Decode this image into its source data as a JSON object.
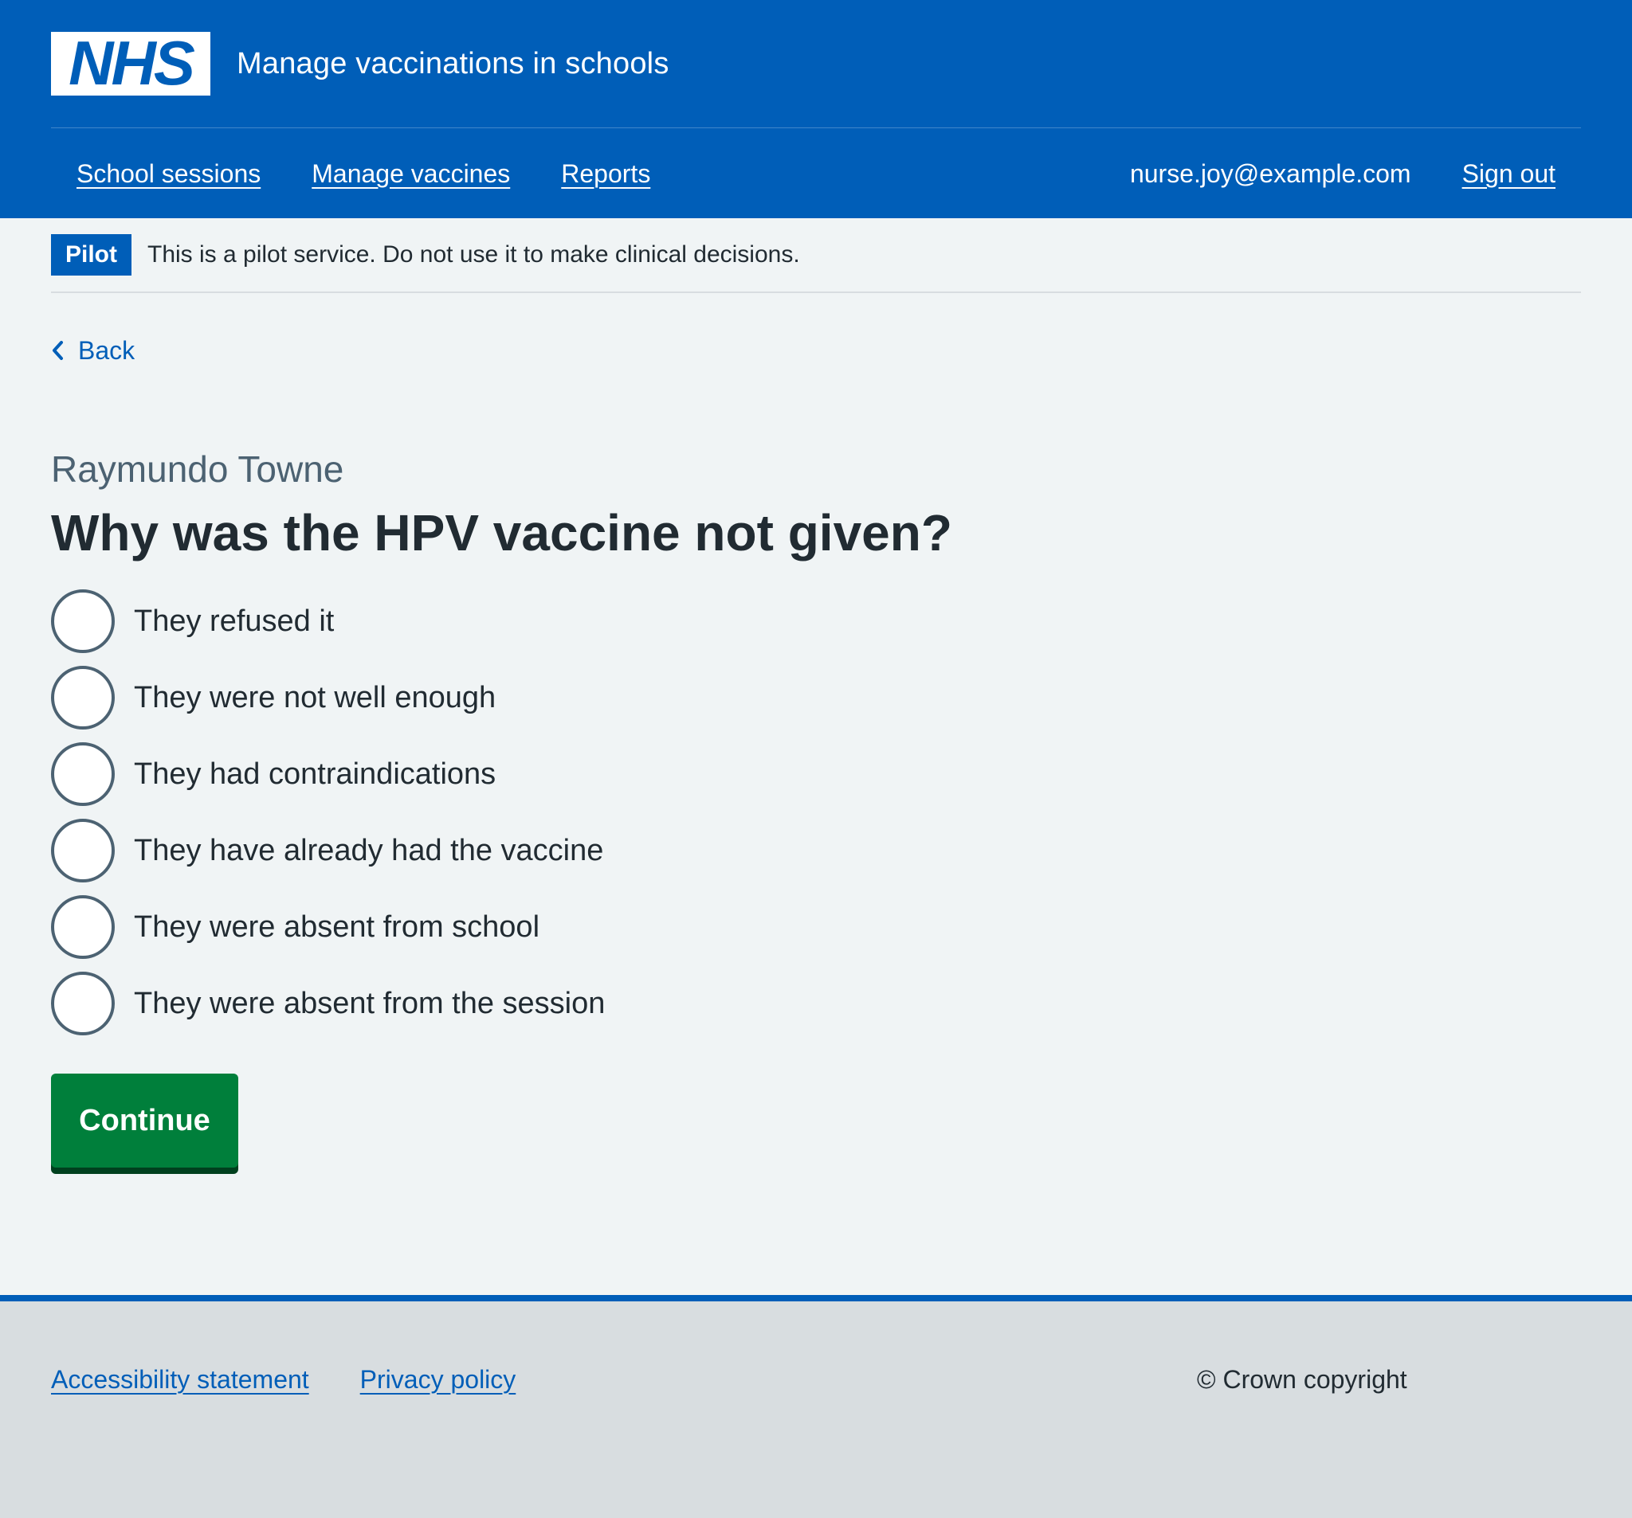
{
  "header": {
    "logo_text": "NHS",
    "service_name": "Manage vaccinations in schools",
    "nav": [
      {
        "label": "School sessions"
      },
      {
        "label": "Manage vaccines"
      },
      {
        "label": "Reports"
      }
    ],
    "user_email": "nurse.joy@example.com",
    "sign_out_label": "Sign out"
  },
  "pilot_banner": {
    "tag": "Pilot",
    "text": "This is a pilot service. Do not use it to make clinical decisions."
  },
  "back_link": {
    "label": "Back",
    "icon": "chevron-left-icon"
  },
  "main": {
    "caption": "Raymundo Towne",
    "heading": "Why was the HPV vaccine not given?",
    "options": [
      {
        "label": "They refused it",
        "selected": false
      },
      {
        "label": "They were not well enough",
        "selected": false
      },
      {
        "label": "They had contraindications",
        "selected": false
      },
      {
        "label": "They have already had the vaccine",
        "selected": false
      },
      {
        "label": "They were absent from school",
        "selected": false
      },
      {
        "label": "They were absent from the session",
        "selected": false
      }
    ],
    "continue_label": "Continue"
  },
  "footer": {
    "links": [
      {
        "label": "Accessibility statement"
      },
      {
        "label": "Privacy policy"
      }
    ],
    "copyright": "© Crown copyright"
  },
  "colors": {
    "brand_blue": "#005eb8",
    "page_bg": "#f0f4f5",
    "button_green": "#007f3b",
    "text": "#212b32",
    "secondary_text": "#4c6272",
    "footer_bg": "#d8dde0"
  }
}
